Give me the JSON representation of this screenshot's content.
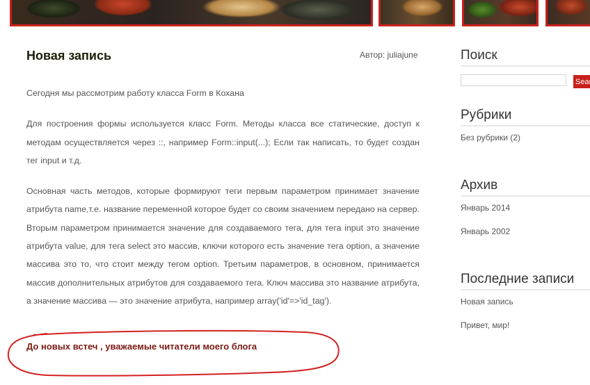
{
  "post": {
    "title": "Новая запись",
    "author": "Автор: juliajune",
    "paragraphs": [
      "Сегодня мы рассмотрим работу класса Form в Кохана",
      "Для построения формы используется класс Form. Методы класса все статические, доступ к методам осуществляется через ::, например Form::input(...); Если так написать, то будет создан тег input и т.д.",
      "Основная часть методов, которые формируют теги первым параметром принимает значение атрибута name,т.е. название переменной которое будет со своим значением передано на сервер. Вторым параметром принимается значение для создаваемого тега, для тега input это значение атрибута value, для тега select это массив, ключи которого есть значение тега option, а значение массива это то, что стоит между тегом option. Третьим параметров, в основном, принимается массив дополнительных атрибутов для создаваемого тега. Ключ массива это название атрибута, а значение массива — это значение атрибута, например array('id'=>'id_tag')."
    ],
    "closing": "До новых встеч , уважаемые читатели моего блога"
  },
  "sidebar": {
    "search": {
      "title": "Поиск",
      "input_value": "",
      "button_label": "Search"
    },
    "categories": {
      "title": "Рубрики",
      "items": [
        "Без рубрики (2)"
      ]
    },
    "archive": {
      "title": "Архив",
      "items": [
        "Январь 2014",
        "Январь 2002"
      ]
    },
    "recent": {
      "title": "Последние записи",
      "items": [
        "Новая запись",
        "Привет, мир!"
      ]
    }
  },
  "colors": {
    "accent": "#c8211c",
    "annotation": "#d42020",
    "closing_text": "#7a1a14"
  }
}
